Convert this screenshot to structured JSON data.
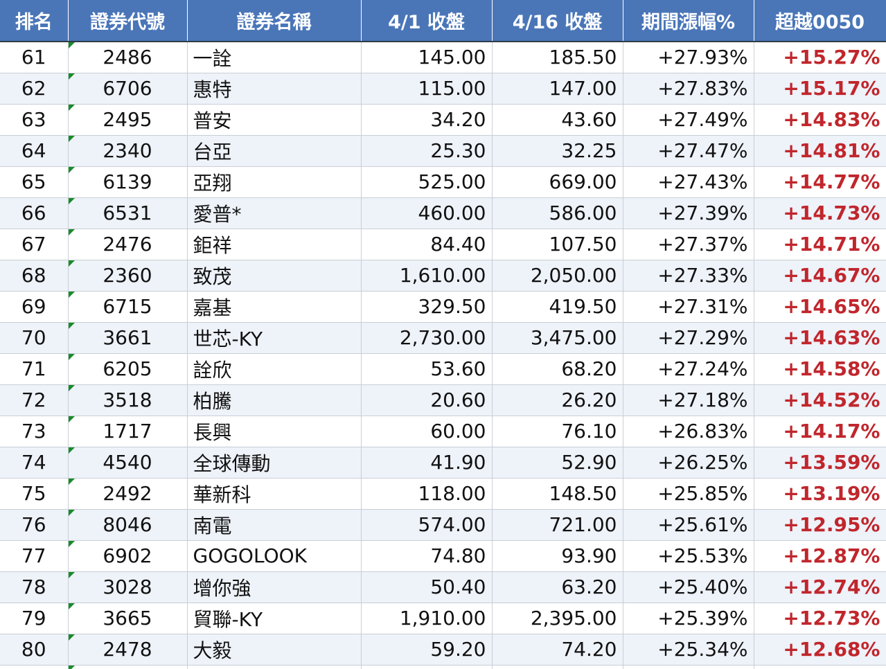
{
  "columns": [
    "排名",
    "證券代號",
    "證券名稱",
    "4/1 收盤",
    "4/16 收盤",
    "期間漲幅%",
    "超越0050"
  ],
  "rows": [
    {
      "rank": "61",
      "code": "2486",
      "name": "一詮",
      "close_0401": "145.00",
      "close_0416": "185.50",
      "change": "+27.93%",
      "excess": "+15.27%"
    },
    {
      "rank": "62",
      "code": "6706",
      "name": "惠特",
      "close_0401": "115.00",
      "close_0416": "147.00",
      "change": "+27.83%",
      "excess": "+15.17%"
    },
    {
      "rank": "63",
      "code": "2495",
      "name": "普安",
      "close_0401": "34.20",
      "close_0416": "43.60",
      "change": "+27.49%",
      "excess": "+14.83%"
    },
    {
      "rank": "64",
      "code": "2340",
      "name": "台亞",
      "close_0401": "25.30",
      "close_0416": "32.25",
      "change": "+27.47%",
      "excess": "+14.81%"
    },
    {
      "rank": "65",
      "code": "6139",
      "name": "亞翔",
      "close_0401": "525.00",
      "close_0416": "669.00",
      "change": "+27.43%",
      "excess": "+14.77%"
    },
    {
      "rank": "66",
      "code": "6531",
      "name": "愛普*",
      "close_0401": "460.00",
      "close_0416": "586.00",
      "change": "+27.39%",
      "excess": "+14.73%"
    },
    {
      "rank": "67",
      "code": "2476",
      "name": "鉅祥",
      "close_0401": "84.40",
      "close_0416": "107.50",
      "change": "+27.37%",
      "excess": "+14.71%"
    },
    {
      "rank": "68",
      "code": "2360",
      "name": "致茂",
      "close_0401": "1,610.00",
      "close_0416": "2,050.00",
      "change": "+27.33%",
      "excess": "+14.67%"
    },
    {
      "rank": "69",
      "code": "6715",
      "name": "嘉基",
      "close_0401": "329.50",
      "close_0416": "419.50",
      "change": "+27.31%",
      "excess": "+14.65%"
    },
    {
      "rank": "70",
      "code": "3661",
      "name": "世芯-KY",
      "close_0401": "2,730.00",
      "close_0416": "3,475.00",
      "change": "+27.29%",
      "excess": "+14.63%"
    },
    {
      "rank": "71",
      "code": "6205",
      "name": "詮欣",
      "close_0401": "53.60",
      "close_0416": "68.20",
      "change": "+27.24%",
      "excess": "+14.58%"
    },
    {
      "rank": "72",
      "code": "3518",
      "name": "柏騰",
      "close_0401": "20.60",
      "close_0416": "26.20",
      "change": "+27.18%",
      "excess": "+14.52%"
    },
    {
      "rank": "73",
      "code": "1717",
      "name": "長興",
      "close_0401": "60.00",
      "close_0416": "76.10",
      "change": "+26.83%",
      "excess": "+14.17%"
    },
    {
      "rank": "74",
      "code": "4540",
      "name": "全球傳動",
      "close_0401": "41.90",
      "close_0416": "52.90",
      "change": "+26.25%",
      "excess": "+13.59%"
    },
    {
      "rank": "75",
      "code": "2492",
      "name": "華新科",
      "close_0401": "118.00",
      "close_0416": "148.50",
      "change": "+25.85%",
      "excess": "+13.19%"
    },
    {
      "rank": "76",
      "code": "8046",
      "name": "南電",
      "close_0401": "574.00",
      "close_0416": "721.00",
      "change": "+25.61%",
      "excess": "+12.95%"
    },
    {
      "rank": "77",
      "code": "6902",
      "name": "GOGOLOOK",
      "close_0401": "74.80",
      "close_0416": "93.90",
      "change": "+25.53%",
      "excess": "+12.87%"
    },
    {
      "rank": "78",
      "code": "3028",
      "name": "增你強",
      "close_0401": "50.40",
      "close_0416": "63.20",
      "change": "+25.40%",
      "excess": "+12.74%"
    },
    {
      "rank": "79",
      "code": "3665",
      "name": "貿聯-KY",
      "close_0401": "1,910.00",
      "close_0416": "2,395.00",
      "change": "+25.39%",
      "excess": "+12.73%"
    },
    {
      "rank": "80",
      "code": "2478",
      "name": "大毅",
      "close_0401": "59.20",
      "close_0416": "74.20",
      "change": "+25.34%",
      "excess": "+12.68%"
    }
  ],
  "colors": {
    "header_bg": "#4a76b8",
    "header_text": "#ffffff",
    "excess_text": "#c0262c",
    "stripe": "#eef2f9",
    "flag": "#1a8a2a"
  }
}
